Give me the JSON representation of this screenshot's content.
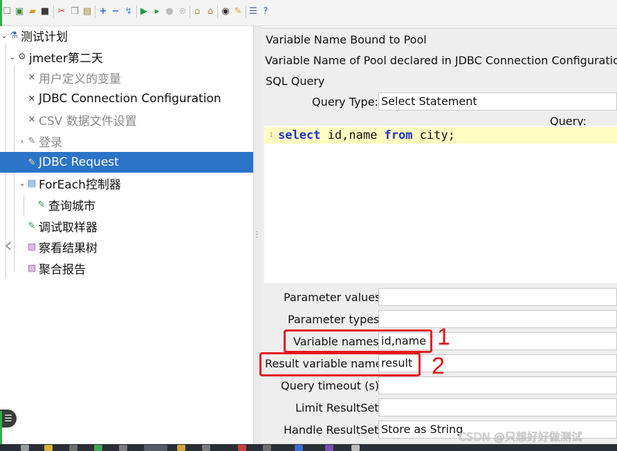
{
  "toolbar": {
    "icons": [
      "new-icon",
      "templates-icon",
      "open-icon",
      "save-icon",
      "cut-icon",
      "copy-icon",
      "paste-icon",
      "expand-icon",
      "collapse-icon",
      "toggle-icon",
      "start-icon",
      "start-no-pause-icon",
      "stop-icon",
      "shutdown-icon",
      "clear-icon",
      "clear-all-icon",
      "search-icon",
      "reset-search-icon",
      "function-helper-icon",
      "help-icon"
    ]
  },
  "tree": {
    "items": [
      {
        "label": "测试计划",
        "icon": "flask-icon"
      },
      {
        "label": "jmeter第二天",
        "icon": "gear-icon"
      },
      {
        "label": "用户定义的变量",
        "icon": "wrench-icon"
      },
      {
        "label": "JDBC Connection Configuration",
        "icon": "wrench-icon"
      },
      {
        "label": "CSV 数据文件设置",
        "icon": "wrench-icon"
      },
      {
        "label": "登录",
        "icon": "pen-icon"
      },
      {
        "label": "JDBC Request",
        "icon": "pen-icon"
      },
      {
        "label": "ForEach控制器",
        "icon": "controller-icon"
      },
      {
        "label": "查询城市",
        "icon": "pen-icon"
      },
      {
        "label": "调试取样器",
        "icon": "pen-icon"
      },
      {
        "label": "察看结果树",
        "icon": "graph-icon"
      },
      {
        "label": "聚合报告",
        "icon": "graph-icon"
      }
    ]
  },
  "form": {
    "var_bound_label": "Variable Name Bound to Pool",
    "pool_declared_label": "Variable Name of Pool declared in JDBC Connection Configuration:",
    "sql_query_label": "SQL Query",
    "query_type_label": "Query Type:",
    "query_type_value": "Select Statement",
    "query_label": "Query:",
    "code_line_number": "1",
    "code_keyword_select": "select",
    "code_columns": " id,name ",
    "code_keyword_from": "from",
    "code_table": " city;",
    "parameter_values_label": "Parameter values:",
    "parameter_values_value": "",
    "parameter_types_label": "Parameter types:",
    "parameter_types_value": "",
    "variable_names_label": "Variable names:",
    "variable_names_value": "id,name",
    "result_variable_label": "Result variable name:",
    "result_variable_value": "result",
    "query_timeout_label": "Query timeout (s):",
    "query_timeout_value": "",
    "limit_resultset_label": "Limit ResultSet:",
    "limit_resultset_value": "",
    "handle_resultset_label": "Handle ResultSet:",
    "handle_resultset_value": "Store as String"
  },
  "annotations": {
    "one": "1",
    "two": "2"
  },
  "watermark": "CSDN @只想好好做测试",
  "colors": {
    "selection": "#2b74c7",
    "annotation": "#e5131b",
    "highlight_line": "#fefcc1",
    "keyword": "#1a32c9"
  }
}
